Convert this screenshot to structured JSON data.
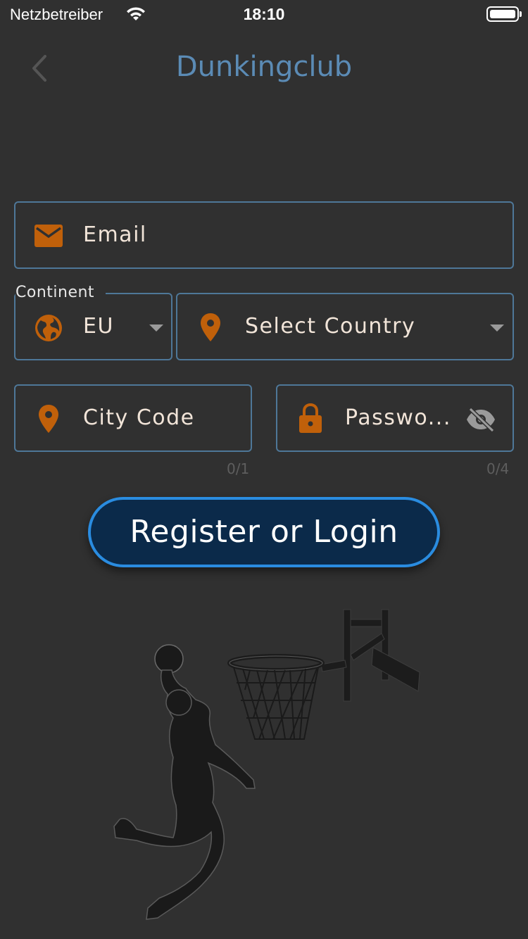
{
  "status_bar": {
    "carrier": "Netzbetreiber",
    "time": "18:10"
  },
  "nav": {
    "title": "Dunkingclub",
    "back_icon": "chevron-left-icon"
  },
  "form": {
    "email": {
      "placeholder": "Email",
      "icon": "mail-icon"
    },
    "continent": {
      "label": "Continent",
      "value": "EU",
      "icon": "globe-icon"
    },
    "country": {
      "placeholder": "Select Country",
      "icon": "location-pin-icon"
    },
    "city_code": {
      "placeholder": "City Code",
      "icon": "location-pin-icon",
      "counter": "0/1"
    },
    "password": {
      "placeholder": "Passwo...",
      "icon": "lock-icon",
      "toggle_icon": "eye-off-icon",
      "counter": "0/4"
    }
  },
  "submit": {
    "label": "Register or Login"
  },
  "colors": {
    "background": "#303030",
    "accent_orange": "#c0600a",
    "border_blue": "#4e7798",
    "title_blue": "#5b8bb5",
    "button_fill": "#0b2a4a",
    "button_border": "#2a8ce0"
  },
  "illustration": {
    "icon": "basketball-dunk-illustration"
  }
}
